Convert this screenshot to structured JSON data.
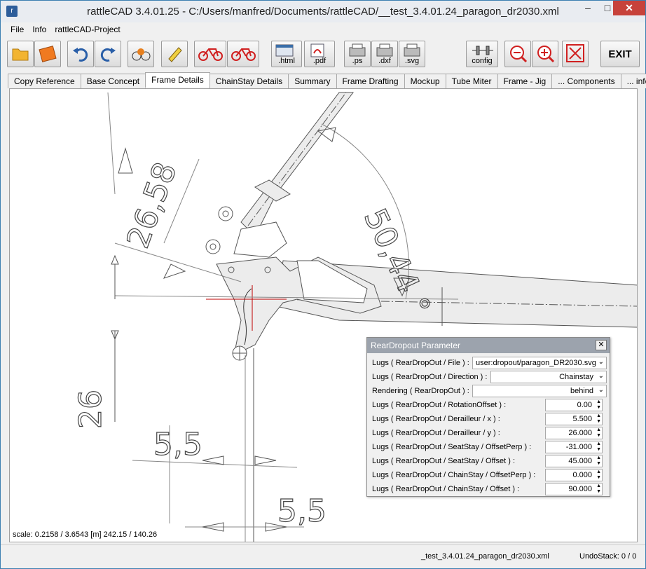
{
  "window": {
    "title": "rattleCAD  3.4.01.25 - C:/Users/manfred/Documents/rattleCAD/__test_3.4.01.24_paragon_dr2030.xml",
    "minimize_glyph": "–",
    "maximize_glyph": "□",
    "close_glyph": "✕"
  },
  "menu": [
    "File",
    "Info",
    "rattleCAD-Project"
  ],
  "toolbar": {
    "html_label": ".html",
    "pdf_label": ".pdf",
    "ps_label": ".ps",
    "dxf_label": ".dxf",
    "svg_label": ".svg",
    "config_label": "config",
    "exit_label": "EXIT",
    "icons": [
      "open-folder-icon",
      "save-disk-icon",
      "undo-icon",
      "redo-icon",
      "render-bike-icon",
      "edit-pencil-icon",
      "bike-red-icon",
      "bike-red-alt-icon",
      "export-html-icon",
      "export-pdf-icon",
      "export-ps-icon",
      "export-dxf-icon",
      "export-svg-icon",
      "config-icon",
      "zoom-out-icon",
      "zoom-in-icon",
      "fit-screen-icon",
      "exit-icon"
    ]
  },
  "tabs": [
    "Copy Reference",
    "Base Concept",
    "Frame Details",
    "ChainStay Details",
    "Summary",
    "Frame Drafting",
    "Mockup",
    "Tube Miter",
    "Frame - Jig",
    "... Components",
    "... info"
  ],
  "active_tab": "Frame Details",
  "canvas": {
    "scale_text": "scale: 0.2158 / 3.6543  [m]  242.15 / 140.26",
    "dim_angle": "50,44 °",
    "dim_26_58": "26,58",
    "dim_26": "26",
    "dim_5_5_a": "5,5",
    "dim_5_5_b": "5,5"
  },
  "panel": {
    "title": "RearDropout Parameter",
    "close_glyph": "✕",
    "rows": [
      {
        "label": "Lugs ( RearDropOut / File ) :",
        "value": "user:dropout/paragon_DR2030.svg",
        "kind": "combo"
      },
      {
        "label": "Lugs ( RearDropOut / Direction ) :",
        "value": "Chainstay",
        "kind": "combo"
      },
      {
        "label": "Rendering ( RearDropOut ) :",
        "value": "behind",
        "kind": "combo"
      },
      {
        "label": "Lugs ( RearDropOut / RotationOffset ) :",
        "value": "0.00",
        "kind": "spin"
      },
      {
        "label": "Lugs ( RearDropOut / Derailleur / x ) :",
        "value": "5.500",
        "kind": "spin"
      },
      {
        "label": "Lugs ( RearDropOut / Derailleur / y ) :",
        "value": "26.000",
        "kind": "spin"
      },
      {
        "label": "Lugs ( RearDropOut / SeatStay / OffsetPerp ) :",
        "value": "-31.000",
        "kind": "spin"
      },
      {
        "label": "Lugs ( RearDropOut / SeatStay / Offset ) :",
        "value": "45.000",
        "kind": "spin"
      },
      {
        "label": "Lugs ( RearDropOut / ChainStay / OffsetPerp ) :",
        "value": "0.000",
        "kind": "spin"
      },
      {
        "label": "Lugs ( RearDropOut / ChainStay / Offset ) :",
        "value": "90.000",
        "kind": "spin"
      }
    ]
  },
  "status": {
    "file": "_test_3.4.01.24_paragon_dr2030.xml",
    "undo": "UndoStack:  0 / 0"
  }
}
